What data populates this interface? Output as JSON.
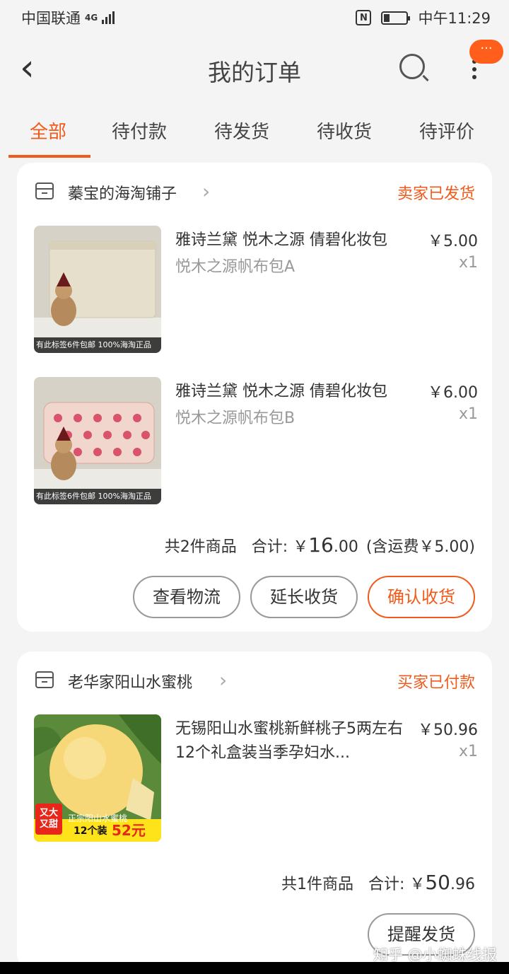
{
  "status_bar": {
    "carrier": "中国联通",
    "network": "4G",
    "nfc": "N",
    "time": "中午11:29"
  },
  "header": {
    "title": "我的订单",
    "badge": "···"
  },
  "tabs": [
    {
      "label": "全部",
      "active": true
    },
    {
      "label": "待付款"
    },
    {
      "label": "待发货"
    },
    {
      "label": "待收货"
    },
    {
      "label": "待评价"
    }
  ],
  "orders": [
    {
      "shop": "蓁宝的海淘铺子",
      "status": "卖家已发货",
      "items": [
        {
          "name": "雅诗兰黛 悦木之源 倩碧化妆包",
          "variant": "悦木之源帆布包A",
          "price": "￥5.00",
          "qty": "x1",
          "thumb_caption": "有此标签6件包邮 100%海淘正品"
        },
        {
          "name": "雅诗兰黛 悦木之源 倩碧化妆包",
          "variant": "悦木之源帆布包B",
          "price": "￥6.00",
          "qty": "x1",
          "thumb_caption": "有此标签6件包邮 100%海淘正品"
        }
      ],
      "summary": {
        "count": "共2件商品",
        "total_label": "合计: ￥",
        "total_int": "16",
        "total_dec": ".00",
        "shipping": "(含运费￥5.00)"
      },
      "buttons": [
        "查看物流",
        "延长收货",
        "确认收货"
      ]
    },
    {
      "shop": "老华家阳山水蜜桃",
      "status": "买家已付款",
      "items": [
        {
          "name": "无锡阳山水蜜桃新鲜桃子5两左右12个礼盒装当季孕妇水...",
          "price": "￥50.96",
          "qty": "x1",
          "thumb_tag": "又大又甜",
          "thumb_caption": "正宗阳山水蜜桃",
          "thumb_promo": "12个装",
          "thumb_price": "52元"
        }
      ],
      "summary": {
        "count": "共1件商品",
        "total_label": "合计: ￥",
        "total_int": "50",
        "total_dec": ".96"
      },
      "buttons": [
        "提醒发货"
      ]
    }
  ],
  "watermark": "知乎 @小蜘蛛线报",
  "colors": {
    "accent": "#f05a1a",
    "background": "#f4f4f4",
    "card": "#ffffff"
  }
}
